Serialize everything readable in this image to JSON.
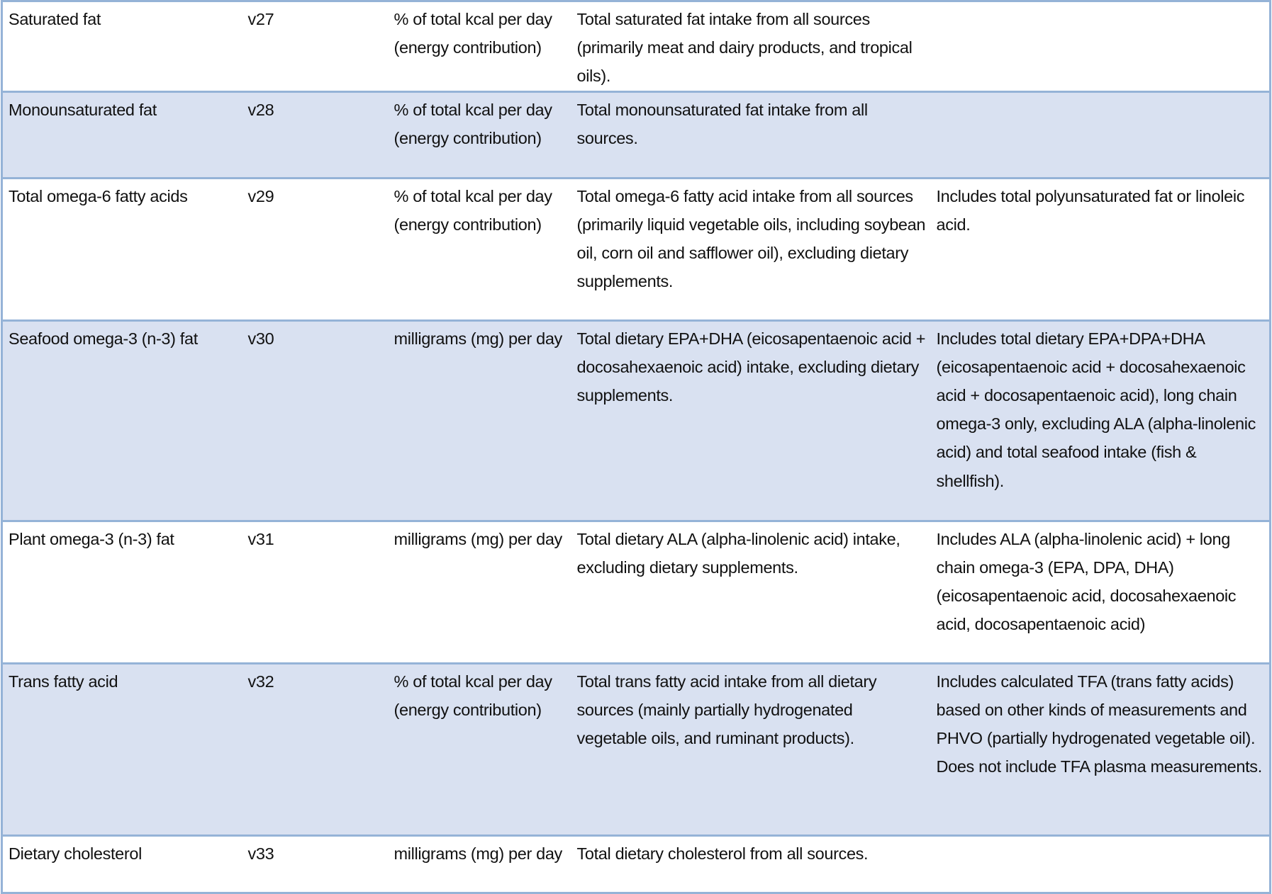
{
  "colors": {
    "shaded_row": "#d9e1f1",
    "border": "#95b3d7"
  },
  "rows": [
    {
      "name": "Saturated fat",
      "code": "v27",
      "unit": "% of total kcal per day (energy contribution)",
      "definition": "Total saturated fat intake from all sources (primarily meat and dairy products, and tropical oils).",
      "notes": ""
    },
    {
      "name": "Monounsaturated fat",
      "code": "v28",
      "unit": "% of total kcal per day (energy contribution)",
      "definition": "Total monounsaturated fat intake from all sources.",
      "notes": ""
    },
    {
      "name": "Total omega-6 fatty acids",
      "code": "v29",
      "unit": "% of total kcal per day (energy contribution)",
      "definition": "Total omega-6 fatty acid intake from all sources (primarily liquid vegetable oils, including soybean oil, corn oil and safflower oil), excluding dietary supplements.",
      "notes": "Includes total polyunsaturated fat or linoleic acid."
    },
    {
      "name": "Seafood omega-3 (n-3) fat",
      "code": "v30",
      "unit": "milligrams (mg) per day",
      "definition": "Total dietary EPA+DHA (eicosapentaenoic acid + docosahexaenoic acid) intake, excluding dietary supplements.",
      "notes": "Includes total dietary EPA+DPA+DHA (eicosapentaenoic acid + docosahexaenoic acid + docosapentaenoic acid), long chain omega-3 only, excluding ALA (alpha-linolenic acid) and total seafood intake (fish & shellfish)."
    },
    {
      "name": "Plant omega-3 (n-3) fat",
      "code": "v31",
      "unit": "milligrams (mg) per day",
      "definition": "Total dietary ALA (alpha-linolenic acid) intake, excluding dietary supplements.",
      "notes": "Includes ALA (alpha-linolenic acid) + long chain omega-3 (EPA, DPA, DHA) (eicosapentaenoic acid, docosahexaenoic acid, docosapentaenoic acid)"
    },
    {
      "name": "Trans fatty acid",
      "code": "v32",
      "unit": "% of total kcal per day (energy contribution)",
      "definition": "Total trans fatty acid intake from all dietary sources (mainly partially hydrogenated vegetable oils, and ruminant products).",
      "notes": "Includes calculated TFA (trans fatty acids) based on other kinds of measurements and PHVO (partially hydrogenated vegetable oil). Does not include TFA plasma measurements."
    },
    {
      "name": "Dietary cholesterol",
      "code": "v33",
      "unit": "milligrams (mg) per day",
      "definition": "Total dietary cholesterol from all sources.",
      "notes": ""
    }
  ]
}
